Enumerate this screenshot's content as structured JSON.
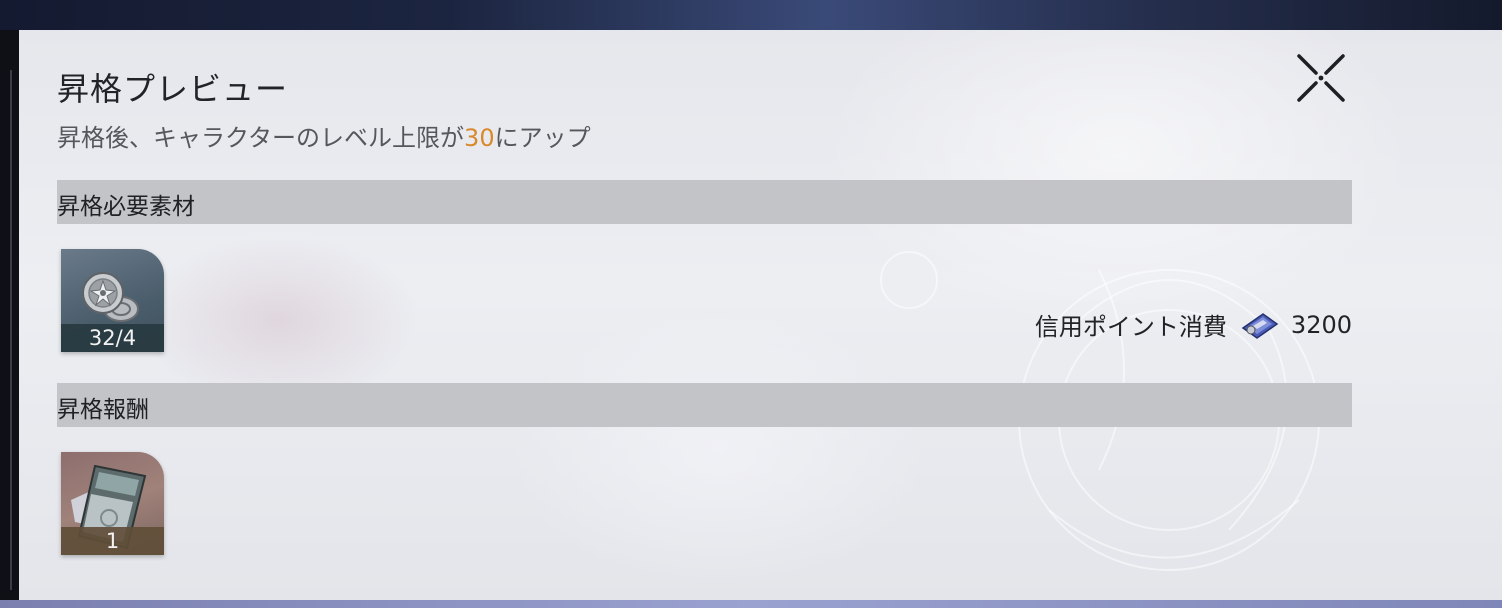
{
  "dialog": {
    "title": "昇格プレビュー",
    "subtitle_prefix": "昇格後、キャラクターのレベル上限が",
    "subtitle_highlight": "30",
    "subtitle_suffix": "にアップ",
    "close_icon": "close-x-icon"
  },
  "materials": {
    "header": "昇格必要素材",
    "items": [
      {
        "icon": "ascension-material-icon",
        "count": "32/4"
      }
    ],
    "cost_label": "信用ポイント消費",
    "cost_icon": "credit-icon",
    "cost_value": "3200"
  },
  "rewards": {
    "header": "昇格報酬",
    "items": [
      {
        "icon": "pass-ticket-icon",
        "count": "1"
      }
    ]
  },
  "colors": {
    "highlight": "#d9892b",
    "section_bar": "#c2c4c8",
    "panel": "#e8e9ed"
  }
}
